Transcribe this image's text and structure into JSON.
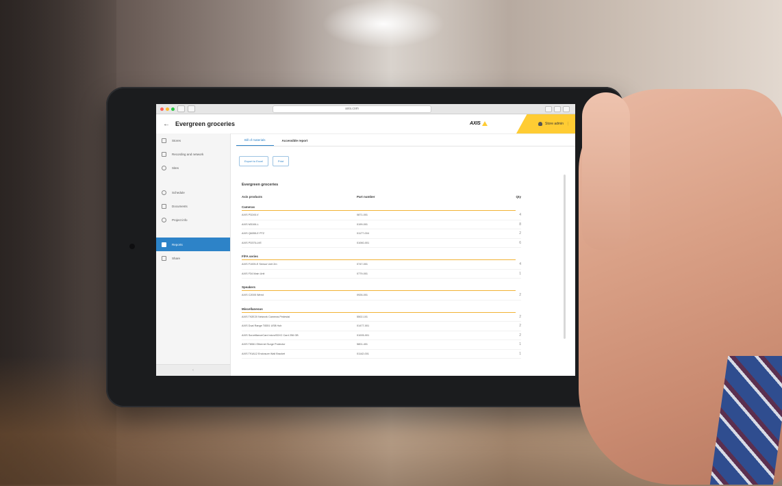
{
  "browser": {
    "url": "axis.com",
    "traffic_colors": [
      "#ff5f57",
      "#febc2e",
      "#28c840"
    ]
  },
  "app": {
    "back_icon": "arrow-left-icon",
    "title": "Evergreen groceries",
    "brand": "AXIS",
    "user_label": "Store admin"
  },
  "sidebar": {
    "items": [
      {
        "label": "Stores",
        "icon": "filter-icon"
      },
      {
        "label": "Recording and network",
        "icon": "grid-icon"
      },
      {
        "label": "Sites",
        "icon": "location-icon"
      },
      {
        "label": "Schedule",
        "icon": "clock-icon"
      },
      {
        "label": "Documents",
        "icon": "document-icon"
      },
      {
        "label": "Project info",
        "icon": "gear-icon"
      },
      {
        "label": "Reports",
        "icon": "report-icon",
        "active": true
      },
      {
        "label": "Share",
        "icon": "share-icon"
      }
    ],
    "collapse_icon": "chevron-left-icon"
  },
  "tabs": [
    {
      "label": "Bill of materials",
      "active": true
    },
    {
      "label": "Accessible report",
      "active": false
    }
  ],
  "buttons": {
    "export": "Export to Excel",
    "print": "Print"
  },
  "report": {
    "title": "Evergreen groceries",
    "columns": [
      "Axis products",
      "Part number",
      "Qty"
    ],
    "groups": [
      {
        "name": "Cameras",
        "rows": [
          {
            "product": "AXIS P3245-V",
            "part": "0871-001",
            "qty": "4"
          },
          {
            "product": "AXIS M3106-L",
            "part": "0199-001",
            "qty": "8"
          },
          {
            "product": "AXIS Q6055-E PTZ",
            "part": "01177-004",
            "qty": "2"
          },
          {
            "product": "AXIS P3375-LVE",
            "part": "01060-001",
            "qty": "6"
          }
        ]
      },
      {
        "name": "F/FA series",
        "rows": [
          {
            "product": "AXIS F1005-E Sensor Unit 2m",
            "part": "0747-001",
            "qty": "4"
          },
          {
            "product": "AXIS F34 Main Unit",
            "part": "0779-001",
            "qty": "1"
          }
        ]
      },
      {
        "name": "Speakers",
        "rows": [
          {
            "product": "AXIS C2005 Wired",
            "part": "0926-001",
            "qty": "2"
          }
        ]
      },
      {
        "name": "Miscellaneous",
        "rows": [
          {
            "product": "AXIS T92E20 Network Cameras Pedestal",
            "part": "5502-101",
            "qty": "2"
          },
          {
            "product": "AXIS Dual Range T8351 USB Hub",
            "part": "01477-001",
            "qty": "2"
          },
          {
            "product": "AXIS SurveillanceCard microSDXC Card 256 GB",
            "part": "01005-001",
            "qty": "2"
          },
          {
            "product": "AXIS T8061 Ethernet Surge Protector",
            "part": "5801-401",
            "qty": "1"
          },
          {
            "product": "AXIS T91A12 Enclosure Wall Bracket",
            "part": "01142-001",
            "qty": "1"
          }
        ]
      }
    ]
  }
}
